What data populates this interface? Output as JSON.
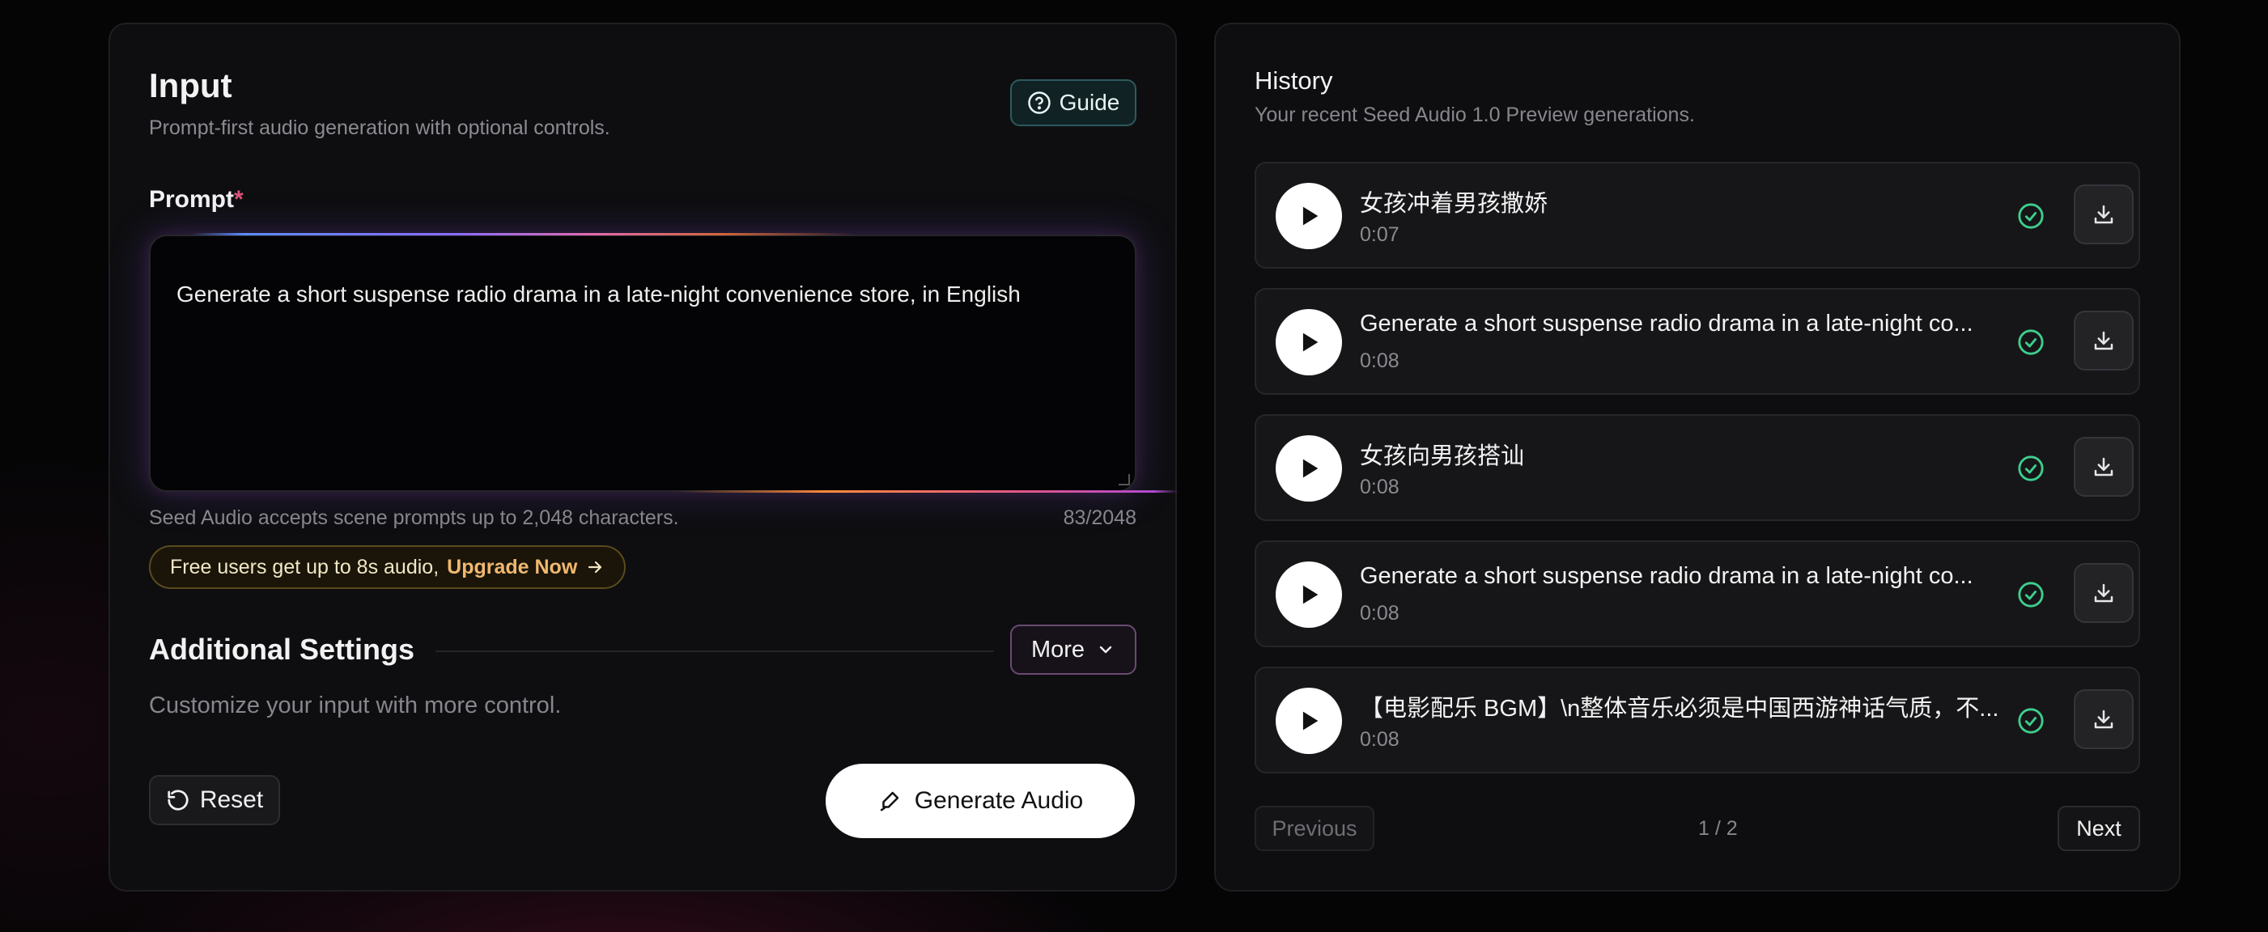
{
  "input": {
    "title": "Input",
    "subtitle": "Prompt-first audio generation with optional controls.",
    "guide_label": "Guide",
    "prompt_label": "Prompt",
    "prompt_required_mark": "*",
    "prompt_value": "Generate a short suspense radio drama in a late-night convenience store, in English",
    "hint": "Seed Audio accepts scene prompts up to 2,048 characters.",
    "char_count": "83/2048",
    "upgrade_text": "Free users get up to 8s audio,",
    "upgrade_link": "Upgrade Now",
    "settings_title": "Additional Settings",
    "settings_subtitle": "Customize your input with more control.",
    "more_label": "More",
    "reset_label": "Reset",
    "generate_label": "Generate Audio"
  },
  "history": {
    "title": "History",
    "subtitle": "Your recent Seed Audio 1.0 Preview generations.",
    "items": [
      {
        "title": "女孩冲着男孩撒娇",
        "duration": "0:07"
      },
      {
        "title": "Generate a short suspense radio drama in a late-night co...",
        "duration": "0:08"
      },
      {
        "title": "女孩向男孩搭讪",
        "duration": "0:08"
      },
      {
        "title": "Generate a short suspense radio drama in a late-night co...",
        "duration": "0:08"
      },
      {
        "title": "【电影配乐 BGM】\\n整体音乐必须是中国西游神话气质，不...",
        "duration": "0:08"
      }
    ],
    "previous_label": "Previous",
    "page": "1 / 2",
    "next_label": "Next"
  },
  "colors": {
    "accent_success": "#3ecf8e",
    "upgrade_link": "#f0b870",
    "required_mark": "#e0557a"
  },
  "icons": {
    "guide": "help-circle-icon",
    "more": "chevron-down-icon",
    "reset": "rotate-ccw-icon",
    "generate": "pen-icon",
    "play": "play-icon",
    "status": "check-circle-icon",
    "download": "download-icon",
    "upgrade": "arrow-right-icon"
  }
}
